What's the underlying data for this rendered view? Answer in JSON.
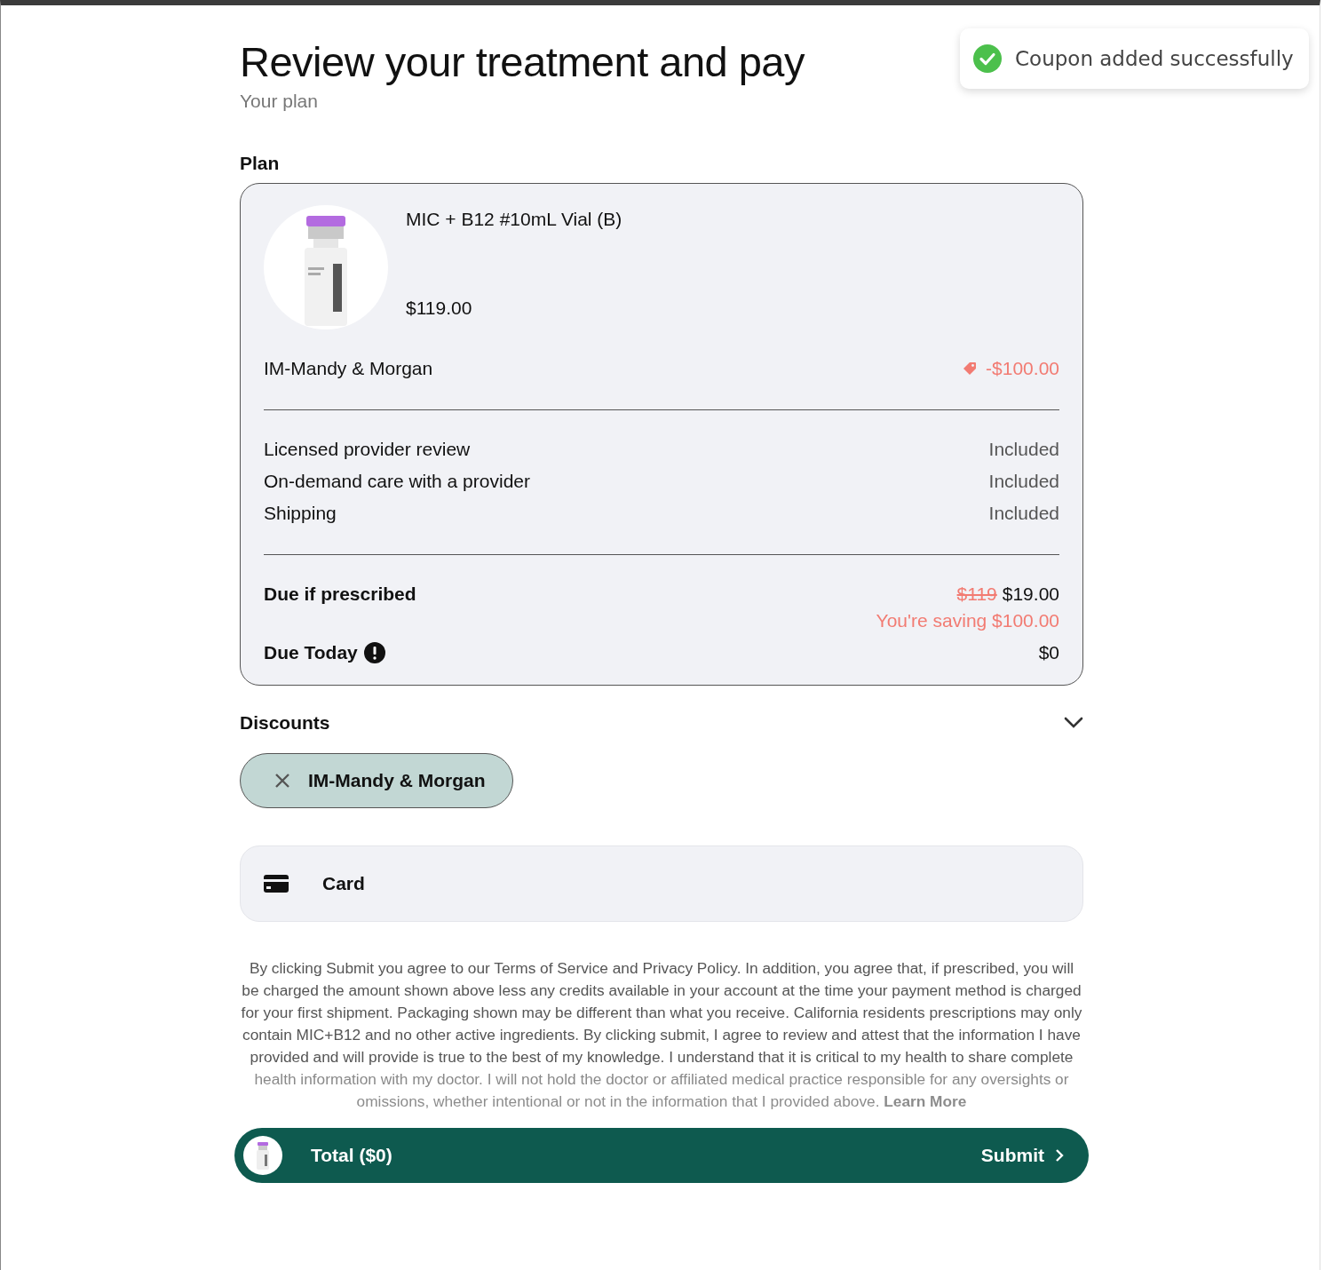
{
  "toast": {
    "message": "Coupon added successfully"
  },
  "header": {
    "title": "Review your treatment and pay",
    "subtitle": "Your plan"
  },
  "plan": {
    "heading": "Plan",
    "product": {
      "name": "MIC + B12 #10mL Vial (B)",
      "price": "$119.00"
    },
    "coupon_line": {
      "label": "IM-Mandy & Morgan",
      "amount": "-$100.00"
    },
    "included": [
      {
        "label": "Licensed provider review",
        "value": "Included"
      },
      {
        "label": "On-demand care with a provider",
        "value": "Included"
      },
      {
        "label": "Shipping",
        "value": "Included"
      }
    ],
    "due_if_prescribed": {
      "label": "Due if prescribed",
      "original_price": "$119",
      "price": "$19.00",
      "savings": "You're saving $100.00"
    },
    "due_today": {
      "label": "Due Today",
      "amount": "$0"
    }
  },
  "discounts": {
    "heading": "Discounts",
    "chips": [
      {
        "label": "IM-Mandy & Morgan"
      }
    ]
  },
  "payment_methods": [
    {
      "label": "Card"
    }
  ],
  "disclaimer": {
    "text": "By clicking Submit you agree to our Terms of Service and Privacy Policy. In addition, you agree that, if prescribed, you will be charged the amount shown above less any credits available in your account at the time your payment method is charged for your first shipment. Packaging shown may be different than what you receive. California residents prescriptions may only contain MIC+B12 and no other active ingredients. By clicking submit, I agree to review and attest that the information I have provided and will provide is true to the best of my knowledge. I understand that it is critical to my health to share complete health information with my doctor. I will not hold the doctor or affiliated medical practice responsible for any oversights or omissions, whether intentional or not in the information that I provided above.",
    "link": "Learn More"
  },
  "total_bar": {
    "total": "Total ($0)",
    "submit": "Submit"
  }
}
